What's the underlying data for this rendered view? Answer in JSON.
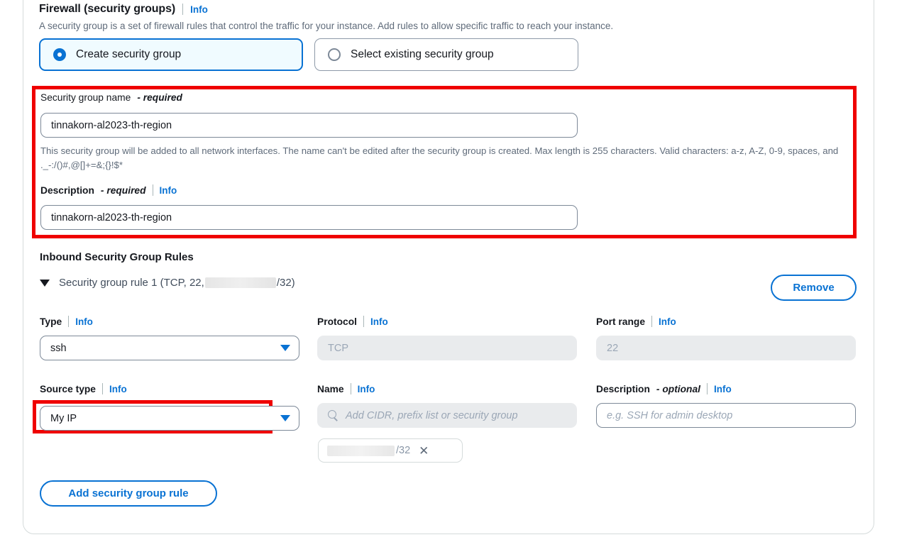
{
  "firewall": {
    "title": "Firewall (security groups)",
    "info_label": "Info",
    "description": "A security group is a set of firewall rules that control the traffic for your instance. Add rules to allow specific traffic to reach your instance.",
    "options": [
      {
        "label": "Create security group",
        "selected": true
      },
      {
        "label": "Select existing security group",
        "selected": false
      }
    ]
  },
  "security_group": {
    "name_label": "Security group name",
    "name_required_suffix": "- required",
    "name_value": "tinnakorn-al2023-th-region",
    "name_helper": "This security group will be added to all network interfaces. The name can't be edited after the security group is created. Max length is 255 characters. Valid characters: a-z, A-Z, 0-9, spaces, and ._-:/()#,@[]+=&;{}!$*",
    "description_label": "Description",
    "description_required_suffix": "- required",
    "description_info": "Info",
    "description_value": "tinnakorn-al2023-th-region"
  },
  "inbound": {
    "section_title": "Inbound Security Group Rules",
    "rule_summary_prefix": "Security group rule 1 (TCP, 22,",
    "rule_summary_suffix": "/32)",
    "remove_label": "Remove",
    "add_rule_label": "Add security group rule",
    "fields": {
      "type": {
        "label": "Type",
        "info": "Info",
        "value": "ssh"
      },
      "protocol": {
        "label": "Protocol",
        "info": "Info",
        "value": "TCP",
        "disabled": true
      },
      "port_range": {
        "label": "Port range",
        "info": "Info",
        "value": "22",
        "disabled": true
      },
      "source_type": {
        "label": "Source type",
        "info": "Info",
        "value": "My IP"
      },
      "name": {
        "label": "Name",
        "info": "Info",
        "placeholder": "Add CIDR, prefix list or security group",
        "disabled": true
      },
      "description": {
        "label": "Description",
        "optional_suffix": "- optional",
        "info": "Info",
        "placeholder": "e.g. SSH for admin desktop"
      }
    },
    "source_chip": {
      "suffix": "/32",
      "remove_glyph": "✕"
    }
  },
  "colors": {
    "accent": "#0972d3",
    "highlight_box": "#ef0000",
    "selected_tile_bg": "#f0fbff",
    "disabled_bg": "#e9ebed"
  }
}
